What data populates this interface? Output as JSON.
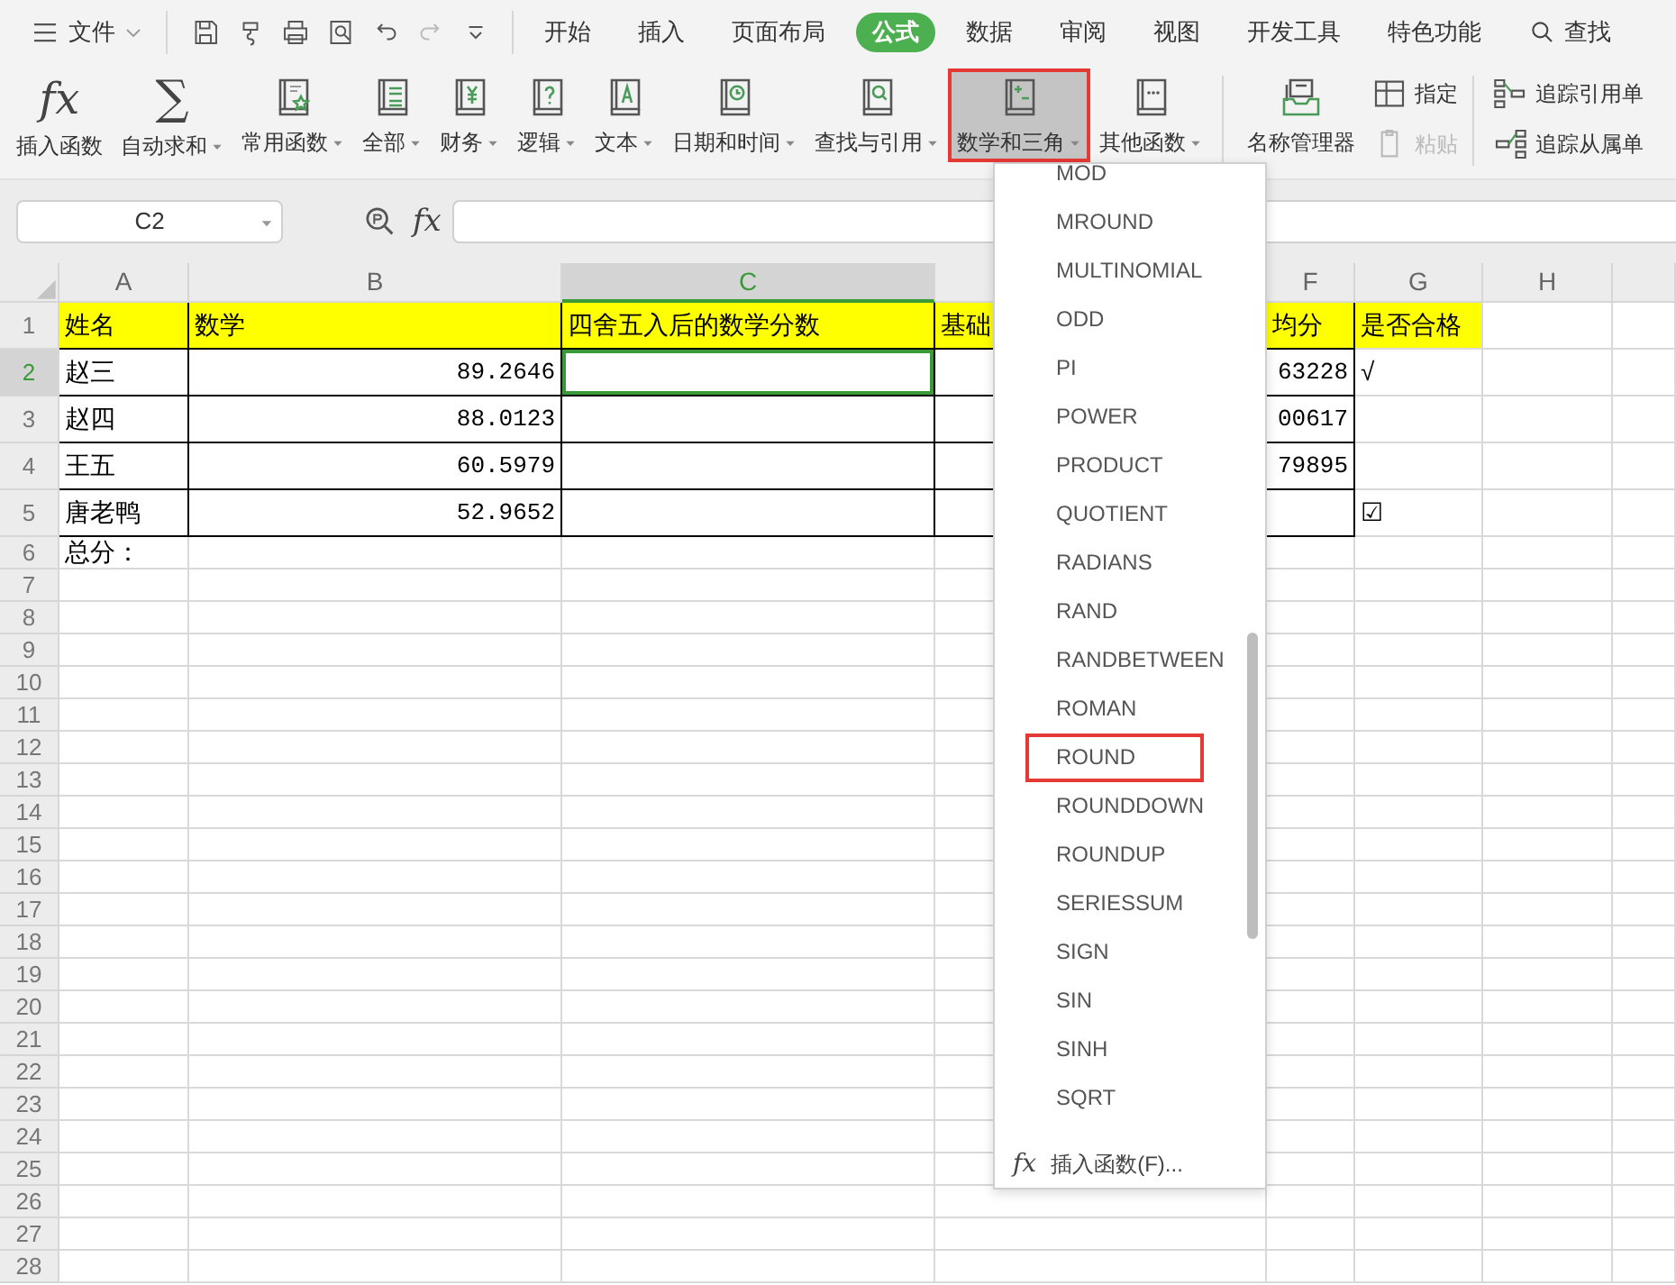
{
  "file_menu": {
    "label": "文件"
  },
  "quick_access": [
    {
      "kind": "save",
      "disabled": false
    },
    {
      "kind": "brush",
      "disabled": false
    },
    {
      "kind": "print",
      "disabled": false
    },
    {
      "kind": "preview",
      "disabled": false
    },
    {
      "kind": "undo",
      "disabled": false
    },
    {
      "kind": "redo",
      "disabled": true
    },
    {
      "kind": "more",
      "disabled": false
    }
  ],
  "tabs": [
    {
      "label": "开始",
      "selected": false
    },
    {
      "label": "插入",
      "selected": false
    },
    {
      "label": "页面布局",
      "selected": false
    },
    {
      "label": "公式",
      "selected": true
    },
    {
      "label": "数据",
      "selected": false
    },
    {
      "label": "审阅",
      "selected": false
    },
    {
      "label": "视图",
      "selected": false
    },
    {
      "label": "开发工具",
      "selected": false
    },
    {
      "label": "特色功能",
      "selected": false
    }
  ],
  "search": {
    "label": "查找"
  },
  "ribbon": {
    "buttons": [
      {
        "label": "插入函数",
        "kind": "fx",
        "icon_text": "fx",
        "dropdown": false,
        "selected": false
      },
      {
        "label": "自动求和",
        "kind": "sigma",
        "icon_text": "∑",
        "dropdown": true,
        "selected": false
      },
      {
        "label": "常用函数",
        "kind": "star-book",
        "dropdown": true,
        "selected": false
      },
      {
        "label": "全部",
        "kind": "fx-book",
        "dropdown": true,
        "selected": false
      },
      {
        "label": "财务",
        "kind": "yen-book",
        "dropdown": true,
        "selected": false
      },
      {
        "label": "逻辑",
        "kind": "question-book",
        "dropdown": true,
        "selected": false
      },
      {
        "label": "文本",
        "kind": "letter-book",
        "dropdown": true,
        "selected": false
      },
      {
        "label": "日期和时间",
        "kind": "clock-book",
        "dropdown": true,
        "selected": false
      },
      {
        "label": "查找与引用",
        "kind": "search-book",
        "dropdown": true,
        "selected": false
      },
      {
        "label": "数学和三角",
        "kind": "plusminus-book",
        "dropdown": true,
        "selected": true
      },
      {
        "label": "其他函数",
        "kind": "dots-book",
        "dropdown": true,
        "selected": false
      },
      {
        "label": "名称管理器",
        "kind": "tray",
        "dropdown": false,
        "selected": false
      }
    ],
    "small_buttons": [
      {
        "label": "指定",
        "kind": "grid",
        "disabled": false
      },
      {
        "label": "粘贴",
        "kind": "clipboard",
        "disabled": true
      }
    ],
    "trace_buttons": [
      {
        "label": "追踪引用单",
        "kind": "precedents"
      },
      {
        "label": "追踪从属单",
        "kind": "dependents"
      }
    ]
  },
  "formula_bar": {
    "name_box": "C2",
    "fx": "fx"
  },
  "columns": [
    {
      "label": "A",
      "selected": false
    },
    {
      "label": "B",
      "selected": false
    },
    {
      "label": "C",
      "selected": true
    },
    {
      "selected": false
    },
    {
      "label": "F",
      "selected": false
    },
    {
      "label": "G",
      "selected": false
    },
    {
      "label": "H",
      "selected": false
    },
    {
      "selected": false
    }
  ],
  "rows": [
    {
      "number": "1",
      "selected": false,
      "kind": "bordered",
      "header": true,
      "cells": {
        "A": {
          "text": "姓名"
        },
        "B": {
          "text": "数学"
        },
        "C": {
          "text": "四舍五入后的数学分数"
        },
        "D": {
          "text": "基础"
        },
        "F": {
          "text": "均分"
        },
        "G": {
          "text": "是否合格"
        }
      }
    },
    {
      "number": "2",
      "selected": true,
      "kind": "bordered",
      "header": false,
      "cells": {
        "A": {
          "text": "赵三"
        },
        "B": {
          "text": "89.2646",
          "kind": "number"
        },
        "F": {
          "text": "63228",
          "kind": "number"
        },
        "G": {
          "text": "√"
        }
      }
    },
    {
      "number": "3",
      "selected": false,
      "kind": "bordered",
      "header": false,
      "cells": {
        "A": {
          "text": "赵四"
        },
        "B": {
          "text": "88.0123",
          "kind": "number"
        },
        "F": {
          "text": "00617",
          "kind": "number"
        }
      }
    },
    {
      "number": "4",
      "selected": false,
      "kind": "bordered",
      "header": false,
      "cells": {
        "A": {
          "text": "王五"
        },
        "B": {
          "text": "60.5979",
          "kind": "number"
        },
        "F": {
          "text": "79895",
          "kind": "number"
        }
      }
    },
    {
      "number": "5",
      "selected": false,
      "kind": "bordered",
      "header": false,
      "cells": {
        "A": {
          "text": "唐老鸭"
        },
        "B": {
          "text": "52.9652",
          "kind": "number"
        },
        "G": {
          "text": "☑"
        }
      }
    },
    {
      "number": "6",
      "selected": false,
      "kind": "plain",
      "header": false,
      "cells": {
        "A": {
          "text": "总分："
        }
      }
    },
    {
      "number": "7",
      "selected": false,
      "kind": "plain",
      "header": false
    },
    {
      "number": "8",
      "selected": false,
      "kind": "plain",
      "header": false
    },
    {
      "number": "9",
      "selected": false,
      "kind": "plain",
      "header": false
    },
    {
      "number": "10",
      "selected": false,
      "kind": "plain",
      "header": false
    },
    {
      "number": "11",
      "selected": false,
      "kind": "plain",
      "header": false
    },
    {
      "number": "12",
      "selected": false,
      "kind": "plain",
      "header": false
    },
    {
      "number": "13",
      "selected": false,
      "kind": "plain",
      "header": false
    },
    {
      "number": "14",
      "selected": false,
      "kind": "plain",
      "header": false
    },
    {
      "number": "15",
      "selected": false,
      "kind": "plain",
      "header": false
    },
    {
      "number": "16",
      "selected": false,
      "kind": "plain",
      "header": false
    },
    {
      "number": "17",
      "selected": false,
      "kind": "plain",
      "header": false
    },
    {
      "number": "18",
      "selected": false,
      "kind": "plain",
      "header": false
    },
    {
      "number": "19",
      "selected": false,
      "kind": "plain",
      "header": false
    },
    {
      "number": "20",
      "selected": false,
      "kind": "plain",
      "header": false
    },
    {
      "number": "21",
      "selected": false,
      "kind": "plain",
      "header": false
    },
    {
      "number": "22",
      "selected": false,
      "kind": "plain",
      "header": false
    },
    {
      "number": "23",
      "selected": false,
      "kind": "plain",
      "header": false
    },
    {
      "number": "24",
      "selected": false,
      "kind": "plain",
      "header": false
    },
    {
      "number": "25",
      "selected": false,
      "kind": "plain",
      "header": false
    },
    {
      "number": "26",
      "selected": false,
      "kind": "plain",
      "header": false
    },
    {
      "number": "27",
      "selected": false,
      "kind": "plain",
      "header": false
    },
    {
      "number": "28",
      "selected": false,
      "kind": "plain",
      "header": false
    }
  ],
  "function_menu": {
    "items": [
      {
        "label": "MOD",
        "selected": false
      },
      {
        "label": "MROUND",
        "selected": false
      },
      {
        "label": "MULTINOMIAL",
        "selected": false
      },
      {
        "label": "ODD",
        "selected": false
      },
      {
        "label": "PI",
        "selected": false
      },
      {
        "label": "POWER",
        "selected": false
      },
      {
        "label": "PRODUCT",
        "selected": false
      },
      {
        "label": "QUOTIENT",
        "selected": false
      },
      {
        "label": "RADIANS",
        "selected": false
      },
      {
        "label": "RAND",
        "selected": false
      },
      {
        "label": "RANDBETWEEN",
        "selected": false
      },
      {
        "label": "ROMAN",
        "selected": false
      },
      {
        "label": "ROUND",
        "selected": true
      },
      {
        "label": "ROUNDDOWN",
        "selected": false
      },
      {
        "label": "ROUNDUP",
        "selected": false
      },
      {
        "label": "SERIESSUM",
        "selected": false
      },
      {
        "label": "SIGN",
        "selected": false
      },
      {
        "label": "SIN",
        "selected": false
      },
      {
        "label": "SINH",
        "selected": false
      },
      {
        "label": "SQRT",
        "selected": false
      }
    ],
    "footer": {
      "icon_text": "fx",
      "label": "插入函数(F)..."
    }
  }
}
